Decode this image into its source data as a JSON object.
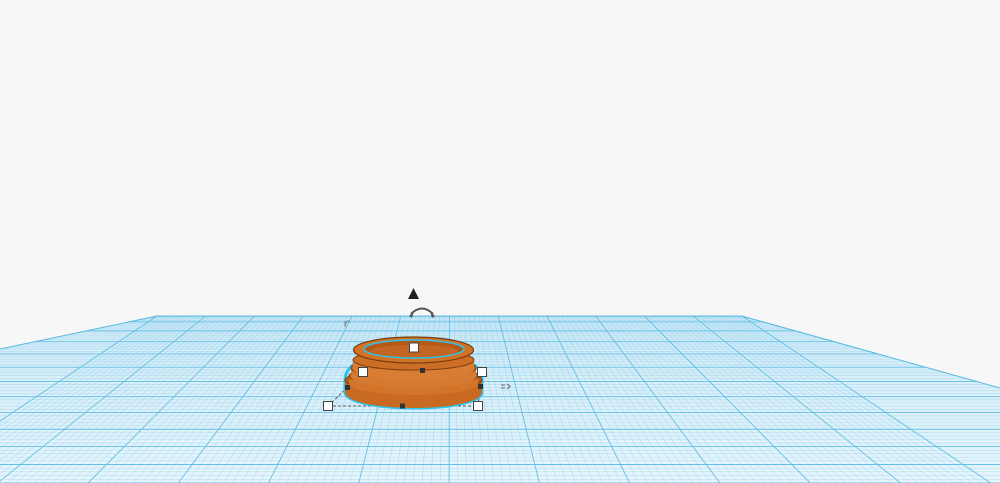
{
  "workspace": {
    "background_color": "#f7f7f7",
    "grid_color": "#58b9e2",
    "grid_fill": "#d6eef9",
    "grid_fill_near": "#e4f4fb"
  },
  "model": {
    "body_color": "#c96a22",
    "body_dark": "#8e4512",
    "body_light": "#e0893d",
    "selection_outline": "#2fc3ee"
  },
  "handles": {
    "handle_fill": "#ffffff",
    "handle_stroke": "#444444",
    "marker_color": "#333333"
  },
  "icons": {
    "lift": "triangle-up-icon",
    "rotate": "rotate-arrow-icon",
    "side_rotate": "small-rotate-icon",
    "dimension": "dimension-arrow-icon"
  }
}
